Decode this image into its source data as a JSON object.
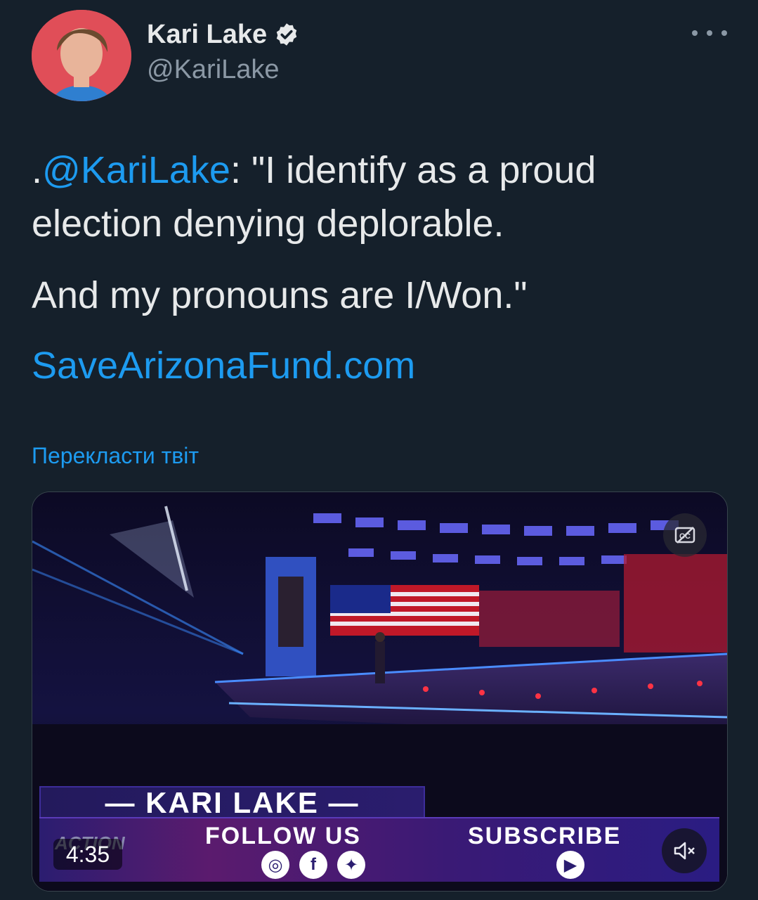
{
  "author": {
    "name": "Kari Lake",
    "handle": "@KariLake"
  },
  "tweet": {
    "prefix": ".",
    "mention": "@KariLake",
    "line1_rest": ": \"I identify as a proud election denying deplorable.",
    "line2": "And my pronouns are I/Won.\"",
    "link": "SaveArizonaFund.com",
    "translate_label": "Перекласти твіт"
  },
  "video": {
    "lower_third_name": "— KARI LAKE —",
    "follow_label": "FOLLOW US",
    "subscribe_label": "SUBSCRIBE",
    "logo_text": "ACTION",
    "duration": "4:35",
    "icons": [
      "cc-icon",
      "mute-icon",
      "instagram-icon",
      "facebook-icon",
      "twitter-icon",
      "youtube-icon"
    ]
  },
  "colors": {
    "background": "#15202b",
    "accent": "#1d9bf0",
    "text": "#e7e9ea",
    "secondary": "#8b98a5"
  }
}
